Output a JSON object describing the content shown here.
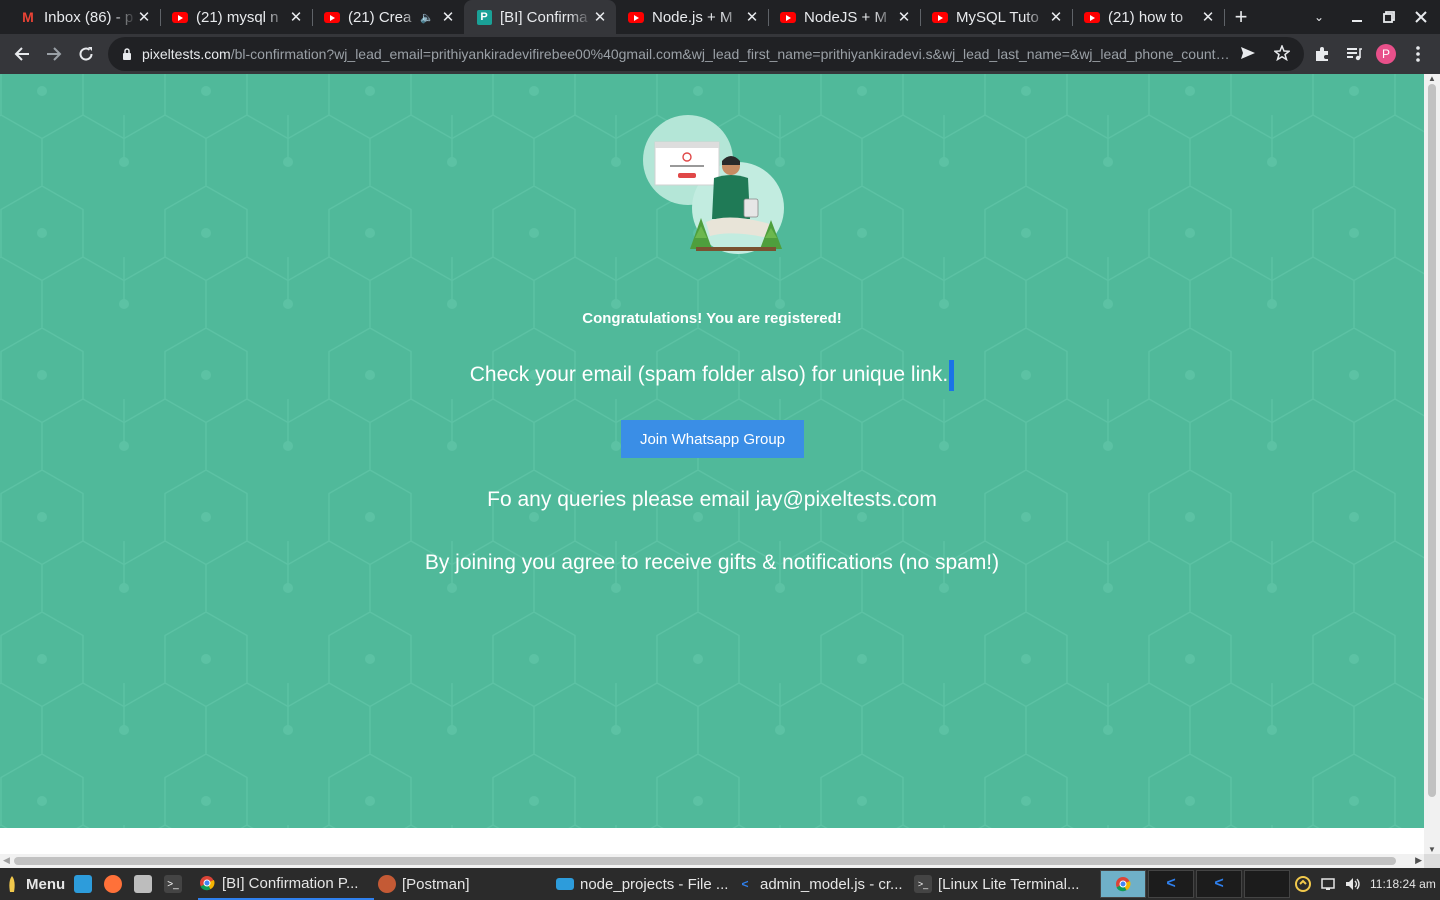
{
  "browser": {
    "tabs": [
      {
        "title": "Inbox (86) - p",
        "icon": "gmail-icon"
      },
      {
        "title": "(21) mysql n",
        "icon": "youtube-icon"
      },
      {
        "title": "(21) Crea",
        "icon": "youtube-icon",
        "audio": "🔈"
      },
      {
        "title": "[BI] Confirma",
        "icon": "pixeltests-icon",
        "favicon_letter": "P",
        "active": true
      },
      {
        "title": "Node.js + M",
        "icon": "youtube-icon"
      },
      {
        "title": "NodeJS + M",
        "icon": "youtube-icon"
      },
      {
        "title": "MySQL Tuto",
        "icon": "youtube-icon"
      },
      {
        "title": "(21) how to",
        "icon": "youtube-icon"
      }
    ],
    "url_host": "pixeltests.com",
    "url_path": "/bl-confirmation?wj_lead_email=prithiyankiradevifirebee00%40gmail.com&wj_lead_first_name=prithiyankiradevi.s&wj_lead_last_name=&wj_lead_phone_country…",
    "profile_initial": "P"
  },
  "page": {
    "congrats": "Congratulations! You are registered!",
    "check_email": "Check your email (spam folder also) for unique link.",
    "whatsapp_button": "Join Whatsapp Group",
    "queries": "Fo any queries please email jay@pixeltests.com",
    "agree": "By joining you agree to receive gifts & notifications (no spam!)",
    "colors": {
      "background": "#50b99a",
      "button": "#3a8ee6"
    }
  },
  "taskbar": {
    "menu_label": "Menu",
    "windows": [
      {
        "title": "[BI] Confirmation P...",
        "icon": "chrome-icon",
        "active": true
      },
      {
        "title": "[Postman]",
        "icon": "postman-icon"
      },
      {
        "title": "node_projects - File ...",
        "icon": "folder-icon"
      },
      {
        "title": "admin_model.js - cr...",
        "icon": "vscode-icon"
      },
      {
        "title": "[Linux Lite Terminal...",
        "icon": "terminal-icon"
      }
    ],
    "clock": "11:18:24 am"
  }
}
